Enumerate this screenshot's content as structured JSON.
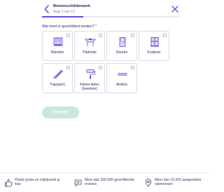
{
  "header": {
    "title": "Binnenschilderwerk",
    "step": "Stap 3 van 10",
    "progress": 0.3
  },
  "question": "Wat moet er geschilderd worden? *",
  "options": [
    {
      "label": "Wanden",
      "icon": "wall-icon"
    },
    {
      "label": "Plafonds",
      "icon": "ceiling-icon"
    },
    {
      "label": "Deuren",
      "icon": "door-icon"
    },
    {
      "label": "Kozijnen",
      "icon": "window-frame-icon"
    },
    {
      "label": "Trap(pen)",
      "icon": "stairs-icon"
    },
    {
      "label": "Kleine delen (kwerken)",
      "icon": "paint-roller-icon"
    },
    {
      "label": "Anders",
      "icon": "more-icon"
    }
  ],
  "continue_label": "Volgende",
  "footer": {
    "features": [
      {
        "text": "Plaats gratis en vrijblijvend je klus",
        "icon": "thumbs-up-icon"
      },
      {
        "text": "Meer dan 330.000 geverifieerde reviews",
        "icon": "chat-icon"
      },
      {
        "text": "Meer dan 10.000 aangesloten vakmensen",
        "icon": "location-icon"
      }
    ]
  },
  "colors": {
    "accent": "#5b4fd8",
    "text": "#2b2660",
    "button_disabled": "#c9e7df"
  }
}
